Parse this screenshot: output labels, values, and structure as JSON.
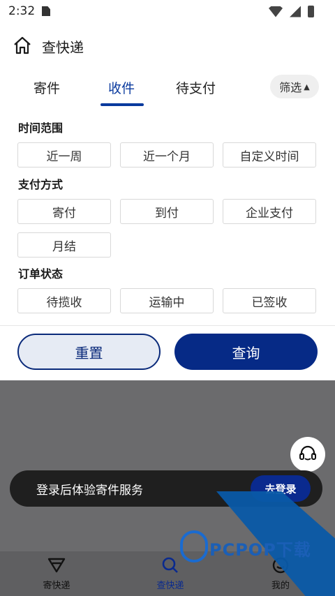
{
  "status": {
    "time": "2:32"
  },
  "header": {
    "title": "查快递"
  },
  "tabs": [
    {
      "label": "寄件"
    },
    {
      "label": "收件"
    },
    {
      "label": "待支付"
    }
  ],
  "filter": {
    "label": "筛选"
  },
  "sections": {
    "time_range": {
      "title": "时间范围",
      "options": [
        "近一周",
        "近一个月",
        "自定义时间"
      ]
    },
    "payment": {
      "title": "支付方式",
      "options": [
        "寄付",
        "到付",
        "企业支付",
        "月结"
      ]
    },
    "order_status": {
      "title": "订单状态",
      "options": [
        "待揽收",
        "运输中",
        "已签收"
      ]
    }
  },
  "actions": {
    "reset": "重置",
    "query": "查询"
  },
  "login_banner": {
    "text": "登录后体验寄件服务",
    "button": "去登录"
  },
  "bottom_nav": [
    {
      "label": "寄快递"
    },
    {
      "label": "查快递"
    },
    {
      "label": "我的"
    }
  ],
  "watermark": {
    "text": "PCPOP下载"
  },
  "colors": {
    "accent": "#0a2a8e",
    "tab_active": "#0a3a9e",
    "overlay": "#6b6b6d"
  }
}
